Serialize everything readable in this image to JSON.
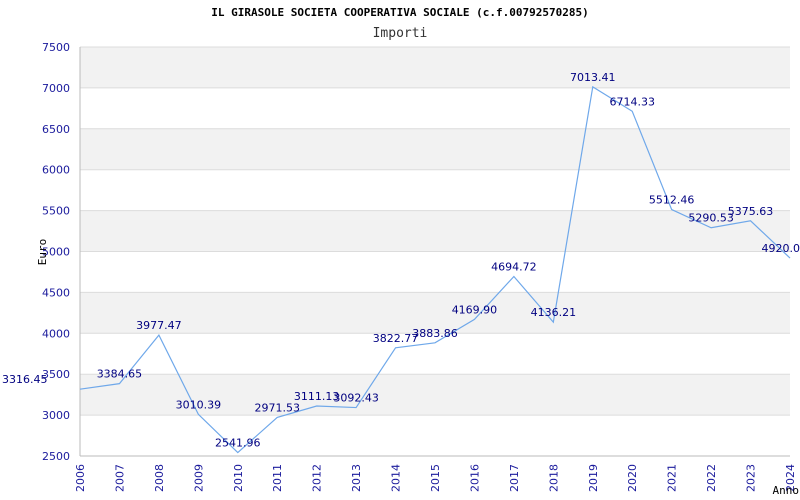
{
  "chart_data": {
    "type": "line",
    "title": "IL GIRASOLE SOCIETA COOPERATIVA SOCIALE (c.f.00792570285)",
    "subtitle": "Importi",
    "xlabel": "Anno",
    "ylabel": "Euro",
    "x": [
      "2006",
      "2007",
      "2008",
      "2009",
      "2010",
      "2011",
      "2012",
      "2013",
      "2014",
      "2015",
      "2016",
      "2017",
      "2018",
      "2019",
      "2020",
      "2021",
      "2022",
      "2023",
      "2024"
    ],
    "values": [
      3316.45,
      3384.65,
      3977.47,
      3010.39,
      2541.96,
      2971.53,
      3111.13,
      3092.43,
      3822.77,
      3883.86,
      4169.9,
      4694.72,
      4136.21,
      7013.41,
      6714.33,
      5512.46,
      5290.53,
      5375.63,
      4920.0
    ],
    "labels": [
      "3316.45",
      "3384.65",
      "3977.47",
      "3010.39",
      "2541.96",
      "2971.53",
      "3111.13",
      "3092.43",
      "3822.77",
      "3883.86",
      "4169.90",
      "4694.72",
      "4136.21",
      "7013.41",
      "6714.33",
      "5512.46",
      "5290.53",
      "5375.63",
      "4920.0"
    ],
    "yticks": [
      "2500",
      "3000",
      "3500",
      "4000",
      "4500",
      "5000",
      "5500",
      "6000",
      "6500",
      "7000",
      "7500"
    ],
    "ylim": [
      2500,
      7500
    ],
    "grid": true,
    "colors": {
      "line": "#6fa8ea",
      "band": "#f2f2f2",
      "tick_text": "#1a1a9c",
      "label_text": "#000080"
    }
  }
}
